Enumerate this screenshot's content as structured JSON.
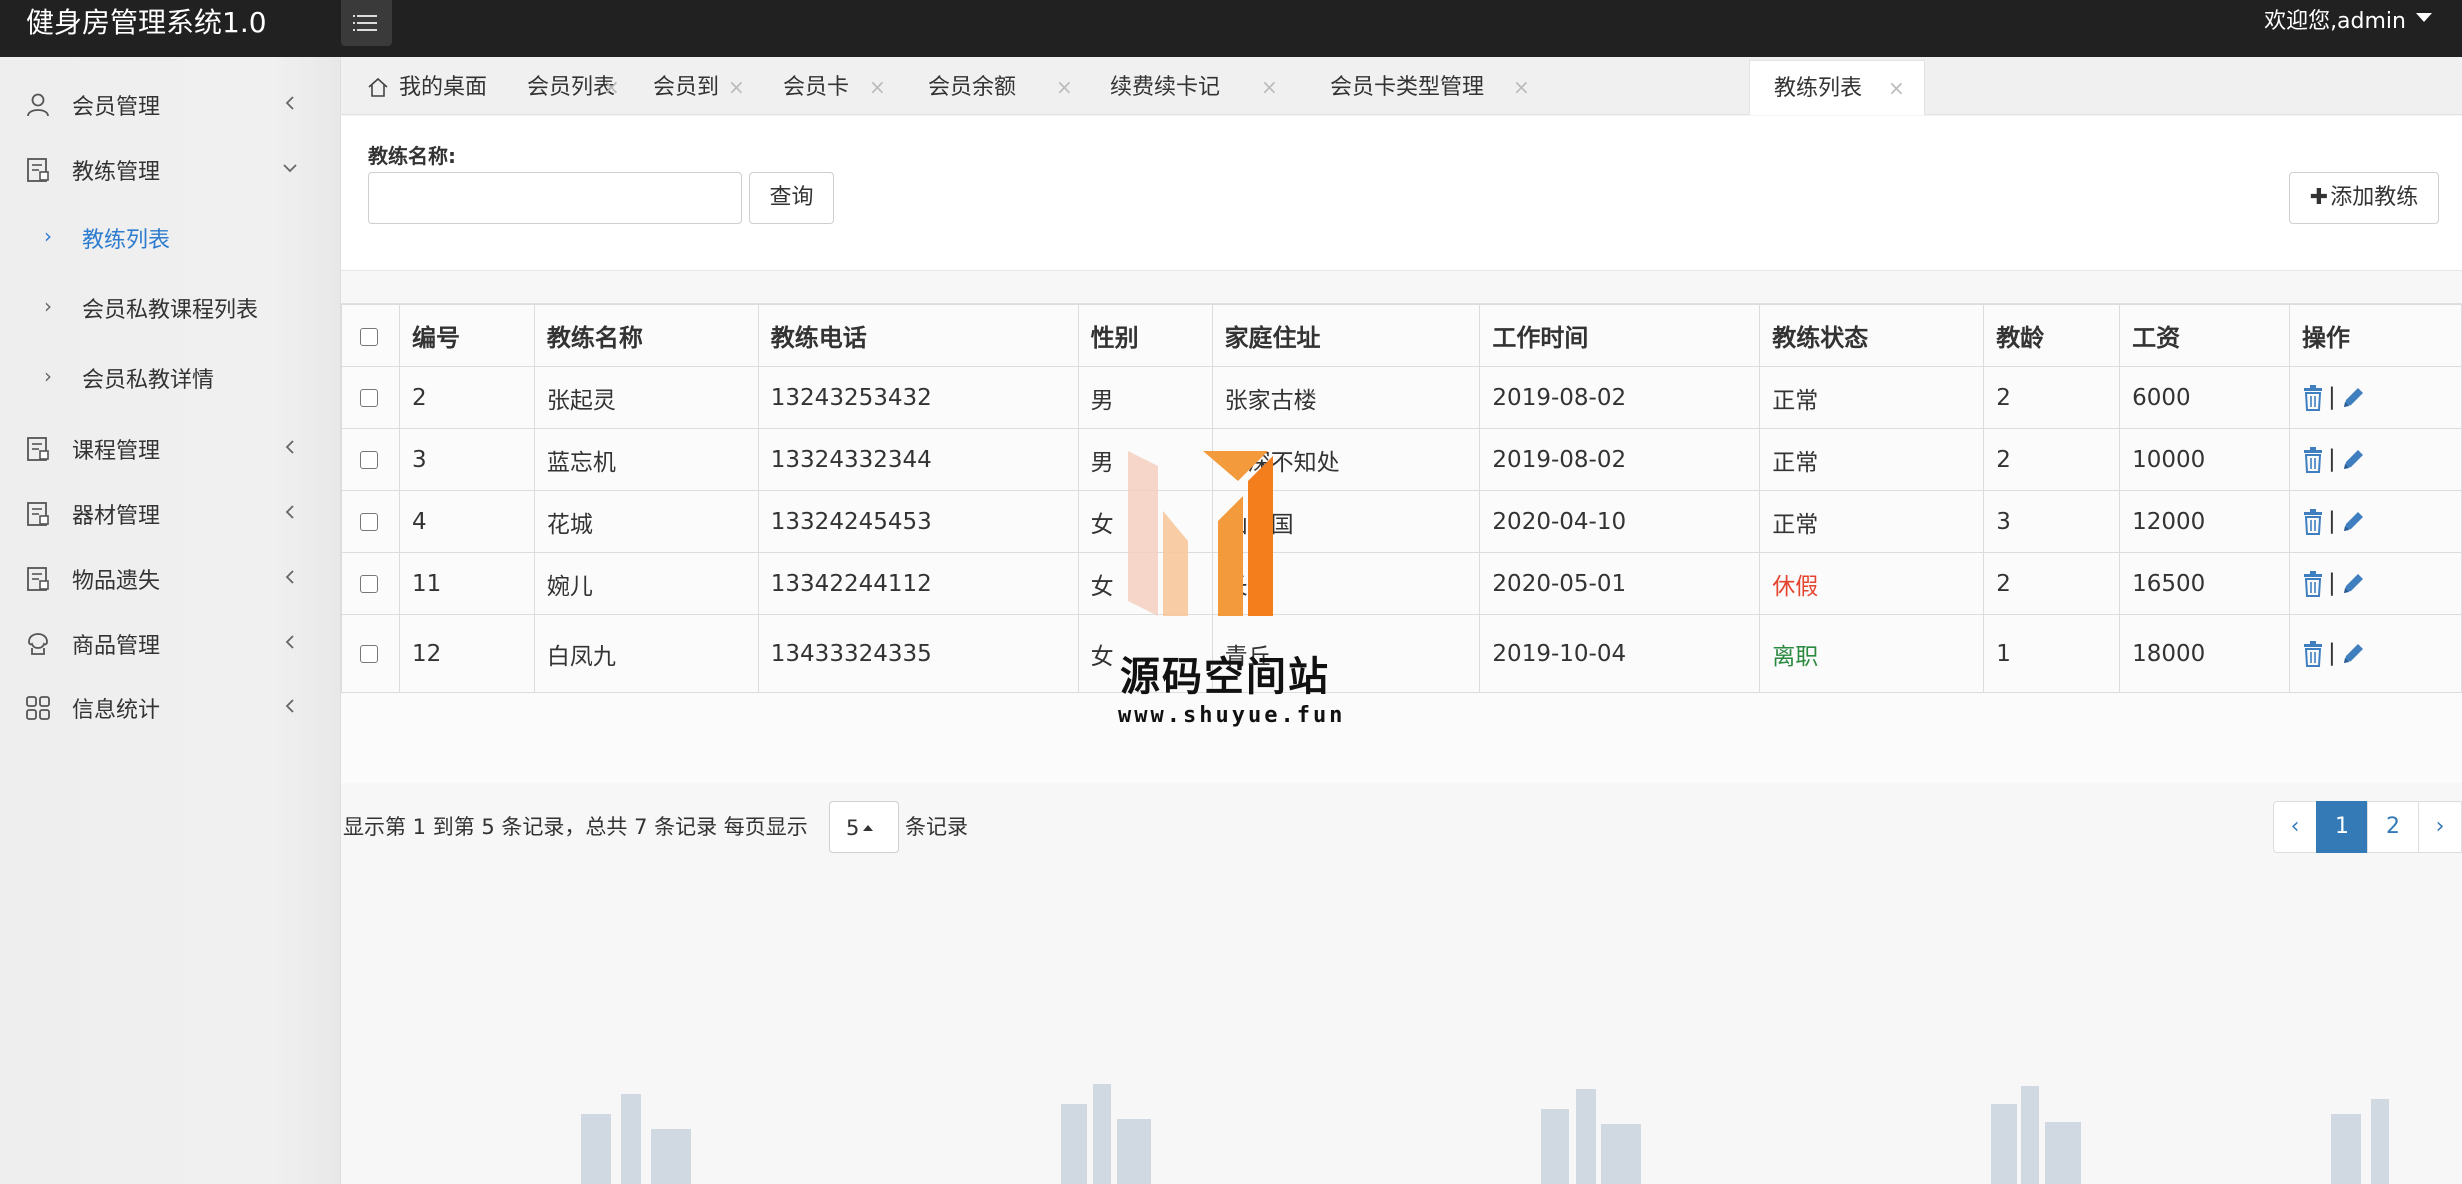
{
  "header": {
    "app_title": "健身房管理系统1.0",
    "welcome": "欢迎您,admin"
  },
  "sidebar": {
    "items": [
      {
        "label": "会员管理",
        "icon": "user-icon"
      },
      {
        "label": "教练管理",
        "icon": "document-icon"
      },
      {
        "label": "课程管理",
        "icon": "document-icon"
      },
      {
        "label": "器材管理",
        "icon": "document-icon"
      },
      {
        "label": "物品遗失",
        "icon": "document-icon"
      },
      {
        "label": "商品管理",
        "icon": "shop-icon"
      },
      {
        "label": "信息统计",
        "icon": "grid-icon"
      }
    ],
    "subitems": [
      {
        "label": "教练列表",
        "active": true
      },
      {
        "label": "会员私教课程列表"
      },
      {
        "label": "会员私教详情"
      }
    ]
  },
  "tabs": [
    {
      "label": "我的桌面"
    },
    {
      "label": "会员列表"
    },
    {
      "label": "会员到期"
    },
    {
      "label": "会员卡续卡"
    },
    {
      "label": "会员余额充值"
    },
    {
      "label": "续费续卡记录"
    },
    {
      "label": "会员卡类型管理"
    },
    {
      "label": "教练列表",
      "active": true
    }
  ],
  "search": {
    "label": "教练名称:",
    "value": "",
    "query_label": "查询",
    "add_label": "添加教练"
  },
  "table": {
    "headers": [
      "编号",
      "教练名称",
      "教练电话",
      "性别",
      "家庭住址",
      "工作时间",
      "教练状态",
      "教龄",
      "工资",
      "操作"
    ],
    "rows": [
      {
        "id": "2",
        "name": "张起灵",
        "phone": "13243253432",
        "gender": "男",
        "address": "张家古楼",
        "date": "2019-08-02",
        "status": "正常",
        "years": "2",
        "salary": "6000"
      },
      {
        "id": "3",
        "name": "蓝忘机",
        "phone": "13324332344",
        "gender": "男",
        "address": "云深不知处",
        "date": "2019-08-02",
        "status": "正常",
        "years": "2",
        "salary": "10000"
      },
      {
        "id": "4",
        "name": "花城",
        "phone": "13324245453",
        "gender": "女",
        "address": "仙乐国",
        "date": "2020-04-10",
        "status": "正常",
        "years": "3",
        "salary": "12000"
      },
      {
        "id": "11",
        "name": "婉儿",
        "phone": "13342244112",
        "gender": "女",
        "address": "长安",
        "date": "2020-05-01",
        "status": "休假",
        "years": "2",
        "salary": "16500"
      },
      {
        "id": "12",
        "name": "白凤九",
        "phone": "13433324335",
        "gender": "女",
        "address": "青丘",
        "date": "2019-10-04",
        "status": "离职",
        "years": "1",
        "salary": "18000"
      }
    ]
  },
  "pagination": {
    "info": "显示第 1 到第 5 条记录，总共 7 条记录 每页显示",
    "page_size": "5",
    "suffix": "条记录",
    "prev": "‹",
    "pages": [
      "1",
      "2"
    ],
    "next": "›",
    "current": "1"
  },
  "watermark": {
    "name": "源码空间站",
    "url": "www.shuyue.fun"
  },
  "colors": {
    "header_bg": "#212121",
    "active_link": "#2e7ccf",
    "status_leave": "#e3452f",
    "status_quit": "#2a8a3e",
    "pager_active": "#337ab7"
  }
}
